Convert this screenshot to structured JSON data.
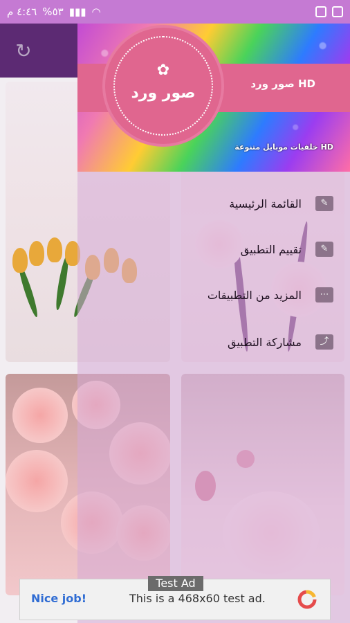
{
  "status_bar": {
    "time": "٤:٤٦ م",
    "battery": "%٥٣"
  },
  "drawer": {
    "logo_title": "صور ورد",
    "header_title": "صور ورد HD",
    "header_subtitle": "خلفيات موبايل متنوعة HD",
    "menu_items": [
      {
        "label": "القائمة الرئيسية",
        "icon": "edit-icon"
      },
      {
        "label": "تقييم التطبيق",
        "icon": "rate-icon"
      },
      {
        "label": "المزيد من التطبيقات",
        "icon": "more-icon"
      },
      {
        "label": "مشاركة التطبيق",
        "icon": "share-icon"
      }
    ]
  },
  "ad": {
    "label": "Test Ad",
    "left_text": "Nice job!",
    "center_text": "This is a 468x60 test ad."
  },
  "colors": {
    "status_bar": "#c57ad3",
    "app_bar": "#5c2a73",
    "drawer_pink": "#e0668f"
  }
}
